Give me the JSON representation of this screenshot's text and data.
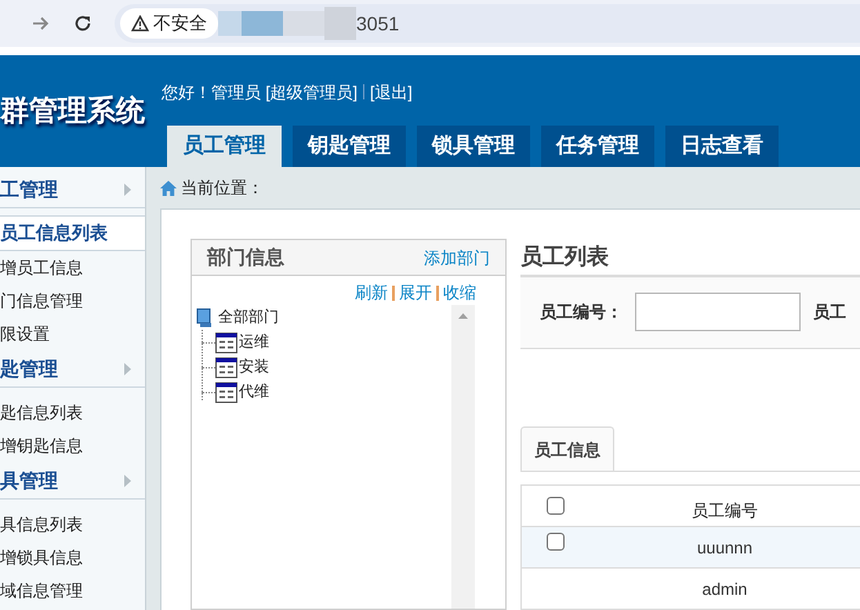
{
  "browser": {
    "warning": "不安全",
    "url": "3051"
  },
  "header": {
    "title": "群管理系统",
    "greeting": "您好！管理员 [超级管理员]",
    "logout": "[退出]"
  },
  "nav_tabs": [
    {
      "label": "员工管理",
      "selected": true
    },
    {
      "label": "钥匙管理",
      "selected": false
    },
    {
      "label": "锁具管理",
      "selected": false
    },
    {
      "label": "任务管理",
      "selected": false
    },
    {
      "label": "日志查看",
      "selected": false
    }
  ],
  "sidebar": [
    {
      "title": "工管理",
      "items": [
        {
          "label": "员工信息列表",
          "selected": true
        },
        {
          "label": "增员工信息",
          "selected": false
        },
        {
          "label": "门信息管理",
          "selected": false
        },
        {
          "label": "限设置",
          "selected": false
        }
      ]
    },
    {
      "title": "匙管理",
      "items": [
        {
          "label": "匙信息列表",
          "selected": false
        },
        {
          "label": "增钥匙信息",
          "selected": false
        }
      ]
    },
    {
      "title": "具管理",
      "items": [
        {
          "label": "具信息列表",
          "selected": false
        },
        {
          "label": "增锁具信息",
          "selected": false
        },
        {
          "label": "域信息管理",
          "selected": false
        }
      ]
    }
  ],
  "breadcrumb": "当前位置：",
  "dept_panel": {
    "title": "部门信息",
    "add_link": "添加部门",
    "actions": [
      "刷新",
      "展开",
      "收缩"
    ],
    "tree": {
      "label": "全部部门",
      "children": [
        {
          "label": "运维"
        },
        {
          "label": "安装"
        },
        {
          "label": "代维"
        }
      ]
    }
  },
  "employee_list": {
    "title": "员工列表",
    "search_fields": [
      {
        "label": "员工编号：",
        "kind": "input"
      },
      {
        "label": "员工",
        "kind": "label"
      }
    ],
    "tab": {
      "label": "员工信息",
      "selected": true
    },
    "columns": [
      "员工编号"
    ],
    "rows": [
      {
        "kind": "checkable",
        "checked": false,
        "cells": [
          "uuunnn"
        ]
      },
      {
        "kind": "plain",
        "cells": [
          "admin"
        ]
      }
    ],
    "header_checkbox": {
      "checked": false
    }
  }
}
